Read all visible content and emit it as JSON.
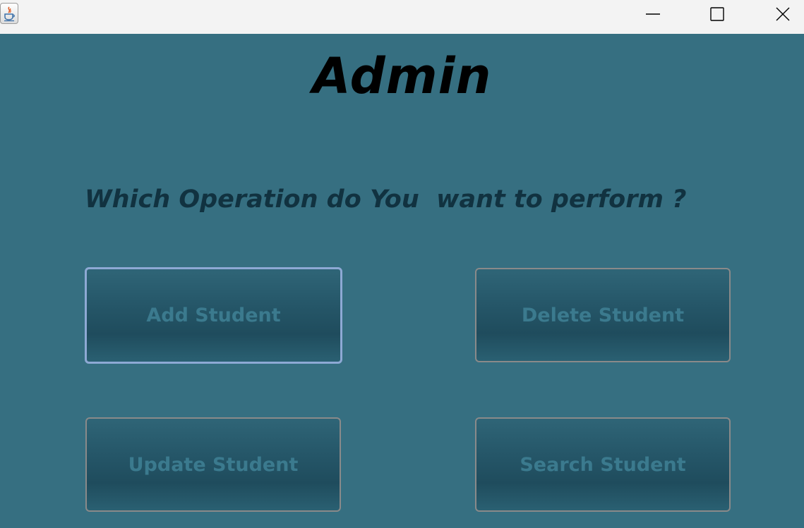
{
  "window": {
    "icon": "java-cup-icon",
    "controls": [
      "minimize-icon",
      "maximize-icon",
      "close-icon"
    ]
  },
  "main": {
    "title": "Admin",
    "question": "Which Operation do You  want to perform ?",
    "buttons": {
      "add": "Add Student",
      "delete": "Delete Student",
      "update": "Update Student",
      "search": "Search Student"
    }
  },
  "colors": {
    "background": "#366f81",
    "button_text": "#3b7a8e",
    "question_text": "#113240",
    "focus_border": "#8ea9d4"
  }
}
